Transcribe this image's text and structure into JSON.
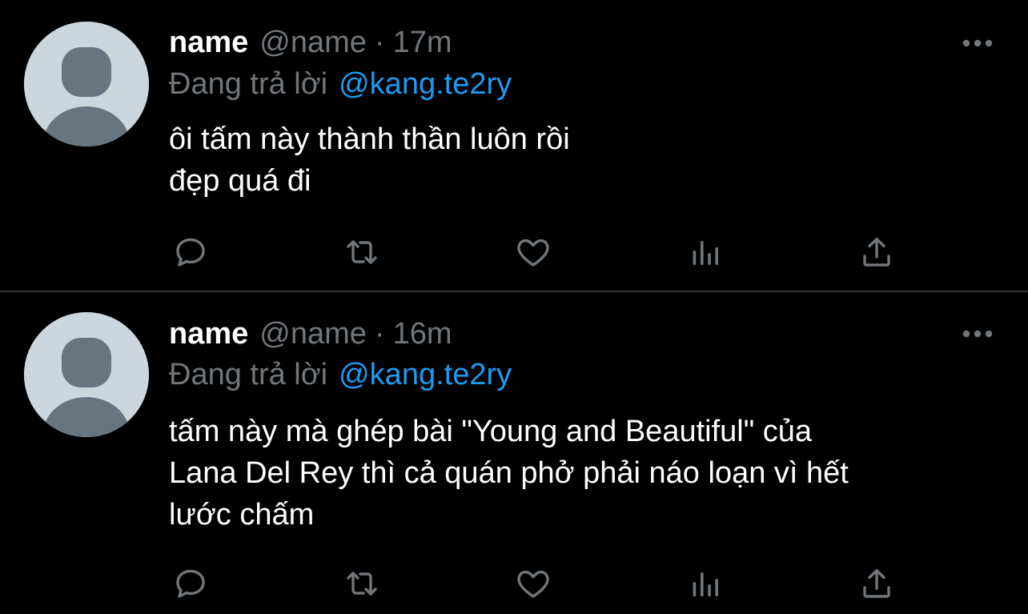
{
  "colors": {
    "background": "#000000",
    "text_primary": "#ffffff",
    "text_secondary": "#71767b",
    "link": "#1d9bf0",
    "divider": "#2f3336",
    "avatar_bg": "#ccd6dd",
    "avatar_fg": "#66757f"
  },
  "tweets": [
    {
      "display_name": "name",
      "handle": "@name",
      "separator": "·",
      "time": "17m",
      "reply_prefix": "Đang trả lời",
      "reply_to": "@kang.te2ry",
      "body_lines": [
        "ôi tấm này thành thần luôn rồi",
        "đẹp quá đi"
      ],
      "icons": [
        "more-icon",
        "reply-icon",
        "retweet-icon",
        "like-icon",
        "views-icon",
        "share-icon"
      ]
    },
    {
      "display_name": "name",
      "handle": "@name",
      "separator": "·",
      "time": "16m",
      "reply_prefix": "Đang trả lời",
      "reply_to": "@kang.te2ry",
      "body_lines": [
        "tấm này mà ghép bài \"Young and Beautiful\" của",
        "Lana Del Rey thì cả quán phở phải náo loạn vì hết",
        "lước chấm"
      ],
      "icons": [
        "more-icon",
        "reply-icon",
        "retweet-icon",
        "like-icon",
        "views-icon",
        "share-icon"
      ]
    }
  ]
}
